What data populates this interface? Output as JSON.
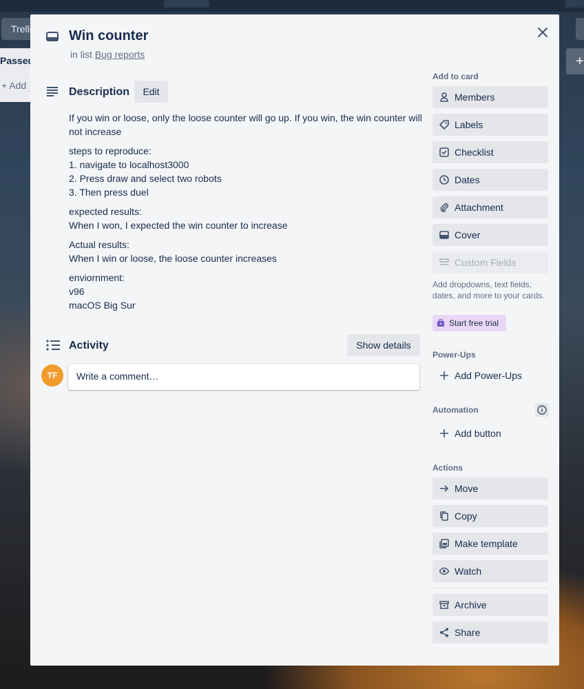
{
  "card": {
    "title": "Win counter",
    "in_list_prefix": "in list",
    "list_name": "Bug reports"
  },
  "background": {
    "header_button_label": "Trello",
    "list_title": "Passed",
    "list_add_label": "+ Add"
  },
  "description": {
    "heading": "Description",
    "edit_label": "Edit",
    "paragraphs": [
      "If you win or loose, only the loose counter will go up. If you win, the win counter will not increase",
      "steps to reproduce:\n1. navigate to localhost3000\n2. Press draw and select two robots\n3. Then press duel",
      "expected results:\nWhen I won, I expected the win counter to increase",
      "Actual results:\nWhen I win or loose, the loose counter increases",
      "enviornment:\nv96\nmacOS Big Sur"
    ]
  },
  "activity": {
    "heading": "Activity",
    "show_details_label": "Show details",
    "avatar_initials": "TF",
    "comment_placeholder": "Write a comment…"
  },
  "sidebar": {
    "add_to_card": {
      "heading": "Add to card",
      "items": [
        {
          "label": "Members",
          "icon": "person-icon"
        },
        {
          "label": "Labels",
          "icon": "tag-icon"
        },
        {
          "label": "Checklist",
          "icon": "checkbox-icon"
        },
        {
          "label": "Dates",
          "icon": "clock-icon"
        },
        {
          "label": "Attachment",
          "icon": "paperclip-icon"
        },
        {
          "label": "Cover",
          "icon": "cover-icon"
        },
        {
          "label": "Custom Fields",
          "icon": "custom-fields-icon"
        }
      ],
      "custom_fields_note": "Add dropdowns, text fields, dates, and more to your cards.",
      "trial_label": "Start free trial"
    },
    "powerups": {
      "heading": "Power-Ups",
      "add_label": "Add Power-Ups"
    },
    "automation": {
      "heading": "Automation",
      "add_label": "Add button"
    },
    "actions": {
      "heading": "Actions",
      "items": [
        {
          "label": "Move",
          "icon": "arrow-right-icon"
        },
        {
          "label": "Copy",
          "icon": "copy-icon"
        },
        {
          "label": "Make template",
          "icon": "template-icon"
        },
        {
          "label": "Watch",
          "icon": "eye-icon"
        },
        {
          "label": "Archive",
          "icon": "archive-icon"
        },
        {
          "label": "Share",
          "icon": "share-icon"
        }
      ]
    }
  },
  "colors": {
    "modal_bg": "#f4f5f7",
    "button_bg": "#e4e6ea",
    "avatar": "#f19b2c",
    "trial_bg": "#ead7f5",
    "text": "#172b4d",
    "muted": "#5e6c84"
  }
}
